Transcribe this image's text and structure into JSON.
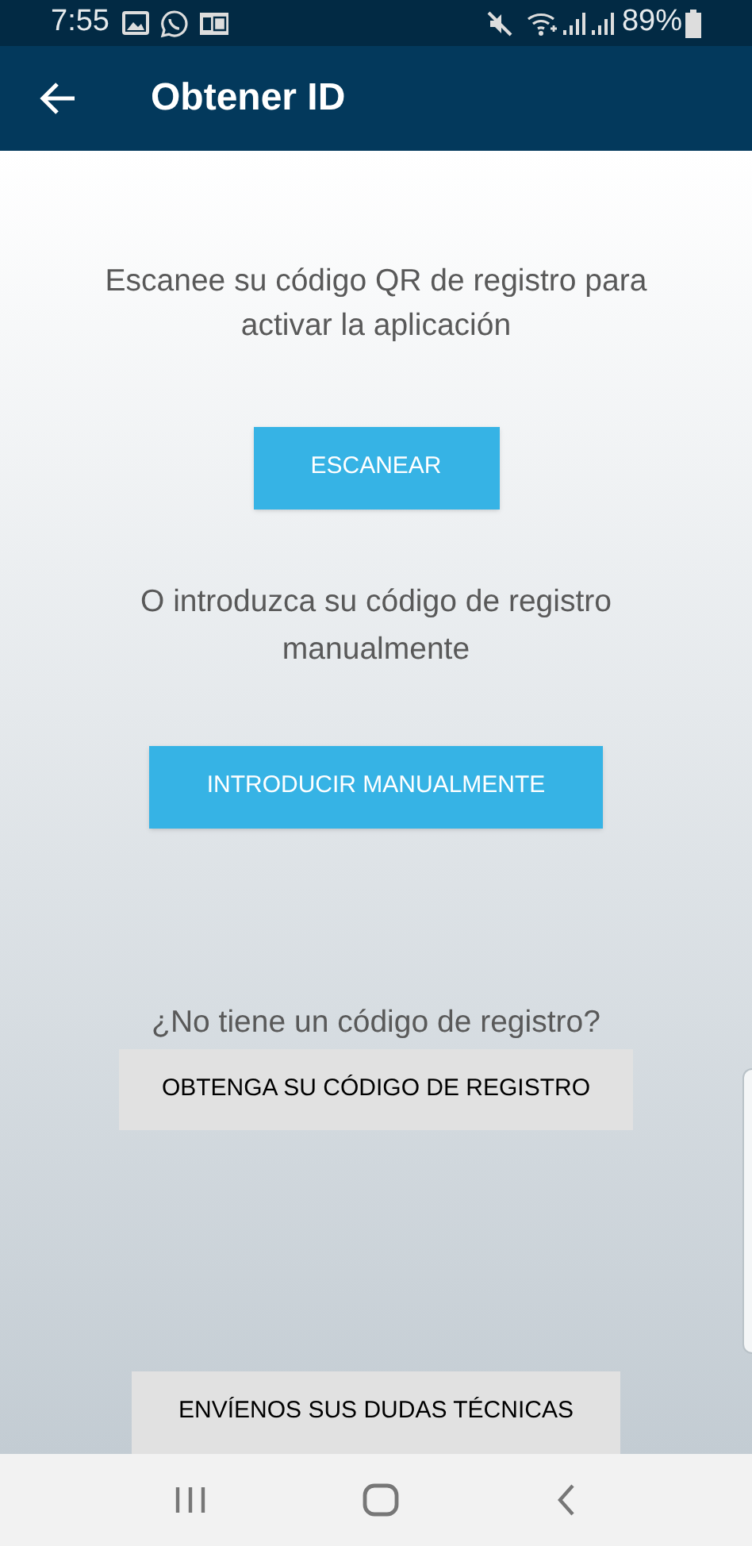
{
  "status_bar": {
    "time": "7:55",
    "battery": "89%"
  },
  "app_bar": {
    "title": "Obtener ID"
  },
  "scan_section": {
    "text": "Escanee su código QR de registro para activar la aplicación",
    "button": "ESCANEAR"
  },
  "manual_section": {
    "text": "O introduzca su código de registro manualmente",
    "button": "INTRODUCIR MANUALMENTE"
  },
  "register_section": {
    "text": "¿No tiene un código de registro?",
    "button": "OBTENGA SU CÓDIGO DE REGISTRO"
  },
  "support_button": "ENVÍENOS SUS DUDAS TÉCNICAS"
}
